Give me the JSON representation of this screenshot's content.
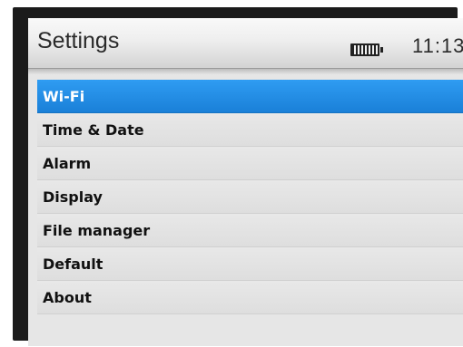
{
  "header": {
    "title": "Settings",
    "time": "11:13",
    "battery_icon": "battery-icon"
  },
  "menu": {
    "selected_index": 0,
    "items": [
      {
        "label": "Wi-Fi"
      },
      {
        "label": "Time & Date"
      },
      {
        "label": "Alarm"
      },
      {
        "label": "Display"
      },
      {
        "label": "File manager"
      },
      {
        "label": "Default"
      },
      {
        "label": "About"
      }
    ]
  },
  "colors": {
    "selection": "#1f8ae0",
    "screen_background": "#e6e6e6",
    "text": "#111111"
  }
}
